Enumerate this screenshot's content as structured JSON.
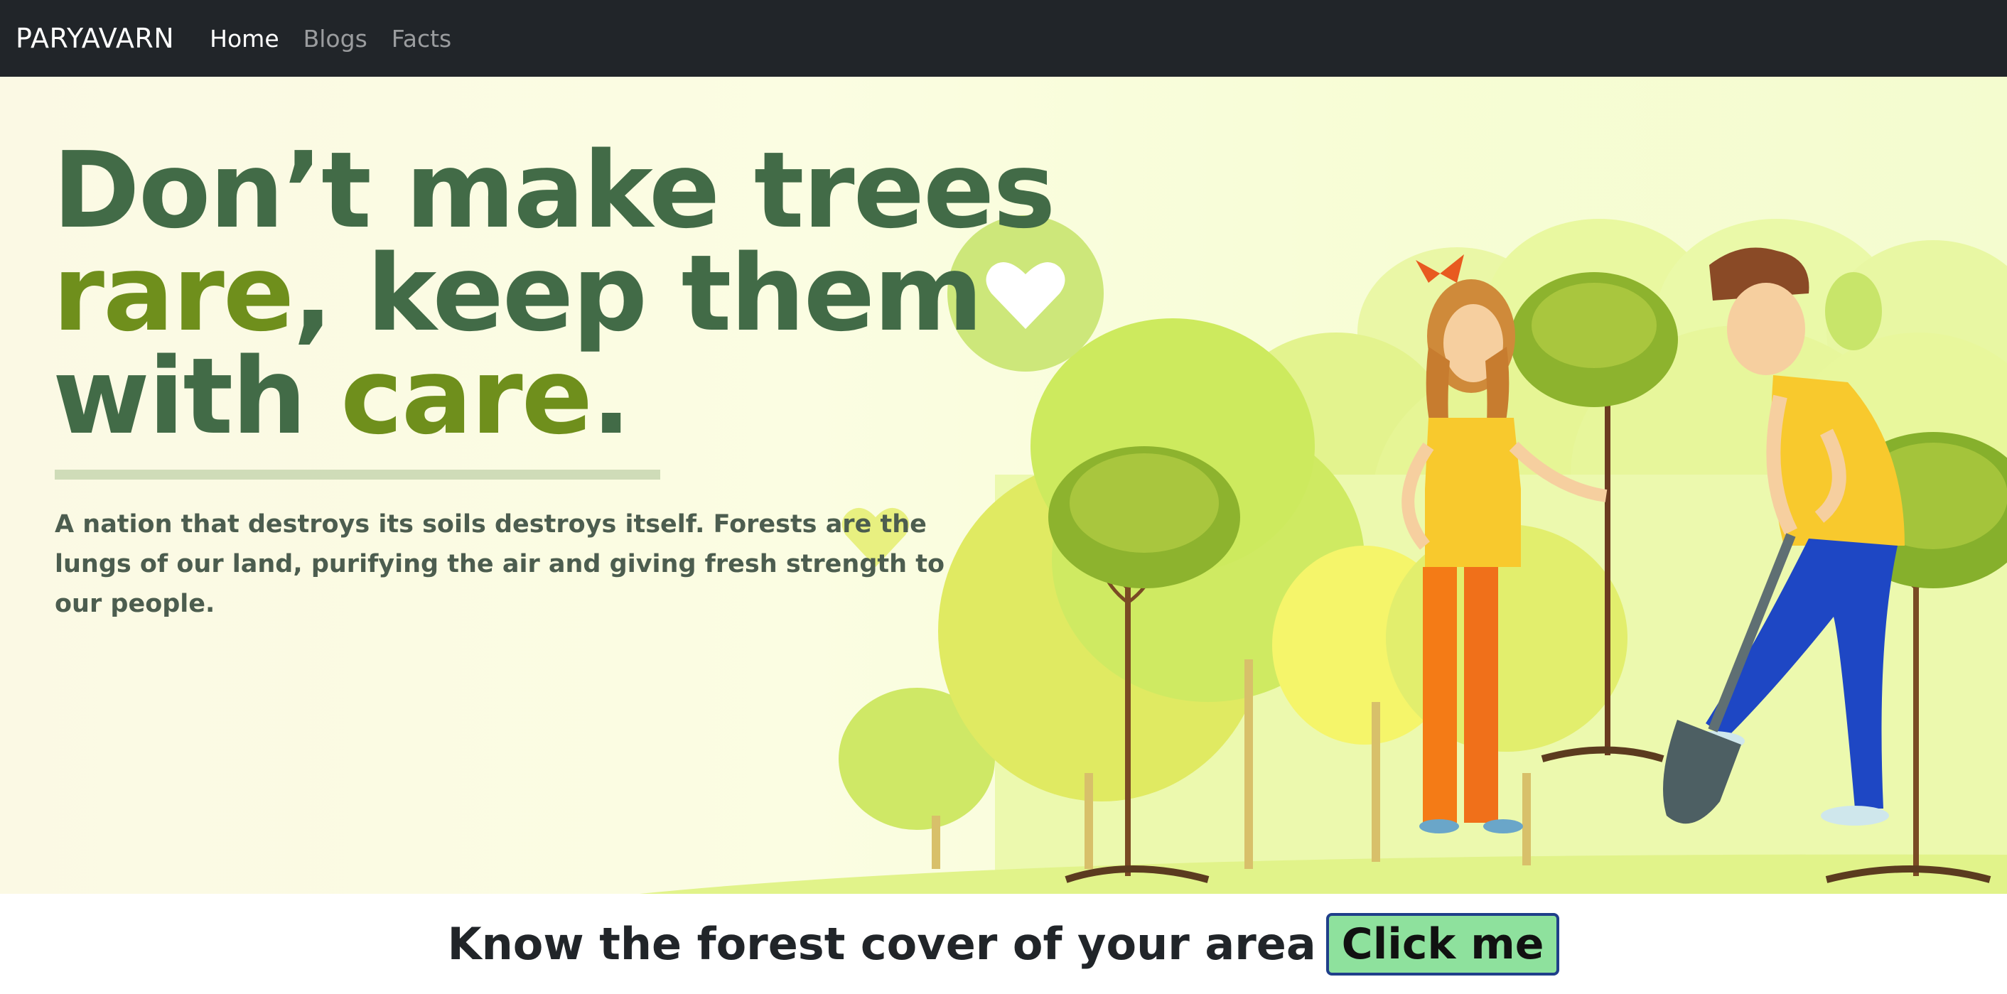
{
  "navbar": {
    "brand": "PARYAVARN",
    "links": [
      {
        "label": "Home",
        "active": true
      },
      {
        "label": "Blogs",
        "active": false
      },
      {
        "label": "Facts",
        "active": false
      }
    ]
  },
  "hero": {
    "headline": {
      "line1": "Don’t make trees",
      "line2_accent": "rare",
      "line2_rest": ", keep them",
      "line3_start": "with ",
      "line3_accent": "care",
      "line3_end": "."
    },
    "lead": "A nation that destroys its soils destroys itself. Forests are the lungs of our land, purifying the air and giving fresh strength to our people.",
    "colors": {
      "headline": "#426b47",
      "accent": "#6f8f1c"
    }
  },
  "cta": {
    "text": "Know the forest cover of your area",
    "button_label": "Click me",
    "button_color": "#8ee19d"
  },
  "icons": [
    "heart-icon",
    "small-heart-icon",
    "girl-illustration",
    "boy-illustration",
    "tree-illustration",
    "shovel-illustration"
  ]
}
